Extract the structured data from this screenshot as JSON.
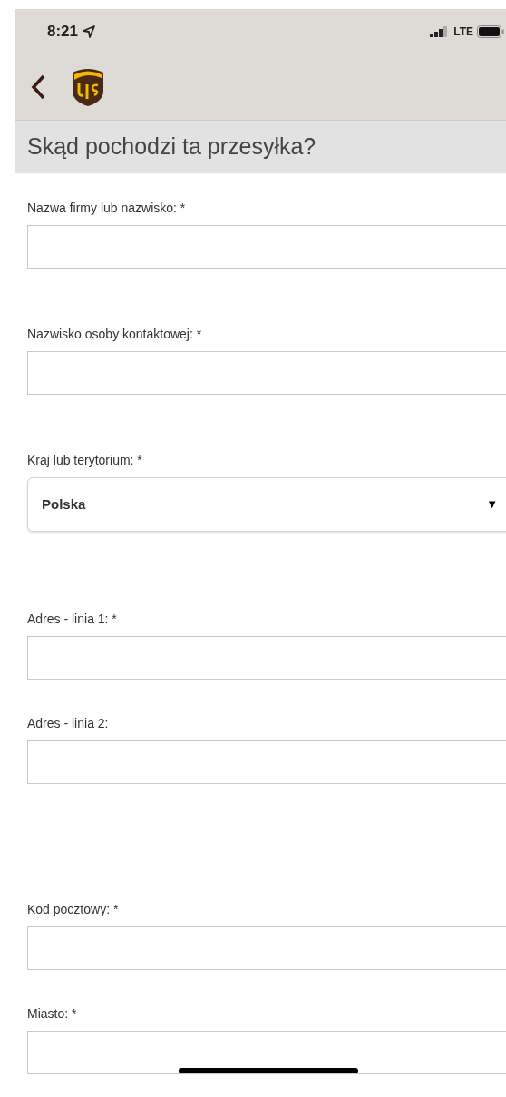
{
  "status_bar": {
    "time": "8:21",
    "network": "LTE"
  },
  "title": "Skąd pochodzi ta przesyłka?",
  "fields": [
    {
      "kind": "text",
      "label": "Nazwa firmy lub nazwisko: *"
    },
    {
      "kind": "text",
      "label": "Nazwisko osoby kontaktowej: *"
    },
    {
      "kind": "select",
      "label": "Kraj lub terytorium: *",
      "value": "Polska",
      "arrow": "▼"
    },
    {
      "kind": "text",
      "label": "Adres - linia 1: *"
    },
    {
      "kind": "text",
      "label": "Adres - linia 2:"
    },
    {
      "kind": "text",
      "label": "Kod pocztowy: *"
    },
    {
      "kind": "text",
      "label": "Miasto: *"
    }
  ]
}
